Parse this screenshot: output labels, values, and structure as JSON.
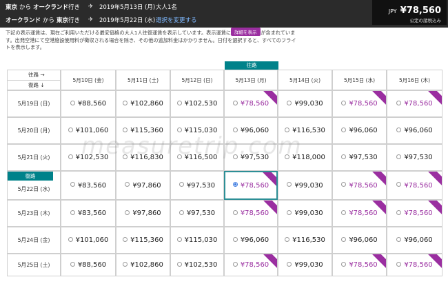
{
  "header": {
    "outbound": {
      "origin": "東京",
      "from": "から",
      "destination": "オークランド",
      "suffix": "行き",
      "date": "2019年5月13日 (月)",
      "pax": "大人1名"
    },
    "return": {
      "origin": "オークランド",
      "from": "から",
      "destination": "東京",
      "suffix": "行き",
      "date": "2019年5月22日 (水)",
      "change_label": "選択を変更する"
    },
    "price": {
      "currency": "JPY",
      "amount": "¥78,560",
      "note": "公定の諸税込み"
    }
  },
  "notice": "下記の表示運賃は、現在ご利用いただける最安価格の大人1人往復運賃を表示しています。表示運賃には公定の諸税が含まれています。出発空港にて空港施設使用料が徴収される場合を除き、その他の追加料金はかかりません。日付を選択すると、すべてのフライトを表示します。",
  "detail_badge": "詳細を表示",
  "outbound_label": "往路",
  "return_label": "復路",
  "corner": {
    "outbound": "往路 →",
    "return": "復路 ↓"
  },
  "columns": [
    "5月10日 (金)",
    "5月11日 (土)",
    "5月12日 (日)",
    "5月13日 (月)",
    "5月14日 (火)",
    "5月15日 (水)",
    "5月16日 (木)"
  ],
  "rows": [
    {
      "label": "5月19日 (日)",
      "prices": [
        "¥88,560",
        "¥102,860",
        "¥102,530",
        "¥78,560",
        "¥99,030",
        "¥78,560",
        "¥78,560"
      ]
    },
    {
      "label": "5月20日 (月)",
      "prices": [
        "¥101,060",
        "¥115,360",
        "¥115,030",
        "¥96,060",
        "¥116,530",
        "¥96,060",
        "¥96,060"
      ]
    },
    {
      "label": "5月21日 (火)",
      "prices": [
        "¥102,530",
        "¥116,830",
        "¥116,500",
        "¥97,530",
        "¥118,000",
        "¥97,530",
        "¥97,530"
      ]
    },
    {
      "label": "5月22日 (水)",
      "prices": [
        "¥83,560",
        "¥97,860",
        "¥97,530",
        "¥78,560",
        "¥99,030",
        "¥78,560",
        "¥78,560"
      ]
    },
    {
      "label": "5月23日 (木)",
      "prices": [
        "¥83,560",
        "¥97,860",
        "¥97,530",
        "¥78,560",
        "¥99,030",
        "¥78,560",
        "¥78,560"
      ]
    },
    {
      "label": "5月24日 (金)",
      "prices": [
        "¥101,060",
        "¥115,360",
        "¥115,030",
        "¥96,060",
        "¥116,530",
        "¥96,060",
        "¥96,060"
      ]
    },
    {
      "label": "5月25日 (土)",
      "prices": [
        "¥88,560",
        "¥102,860",
        "¥102,530",
        "¥78,560",
        "¥99,030",
        "¥78,560",
        "¥78,560"
      ]
    }
  ],
  "lowest_fare": "¥78,560",
  "watermark": "measuretrip.com",
  "colors": {
    "accent_purple": "#9a2ea0",
    "teal": "#00828a",
    "header_bg": "#2b2b2b"
  }
}
